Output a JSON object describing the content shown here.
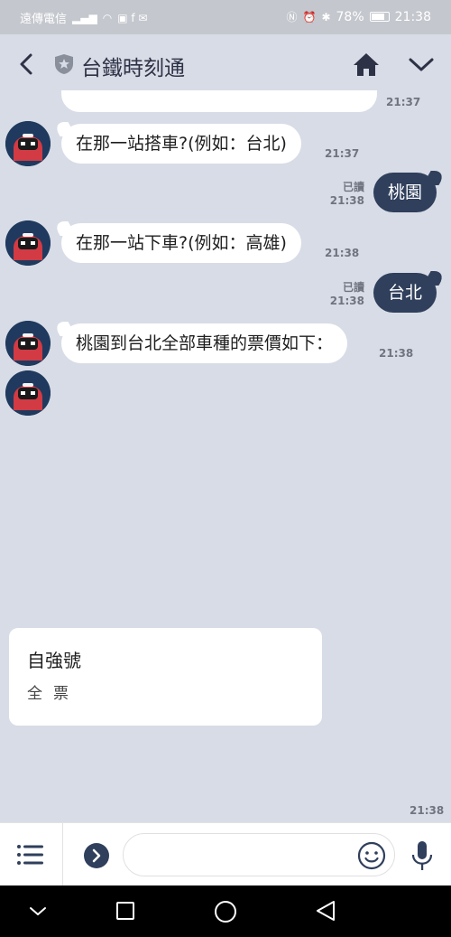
{
  "status_bar": {
    "carrier": "遠傳電信",
    "battery": "78%",
    "battery_level": 0.78,
    "time": "21:38"
  },
  "header": {
    "title": "台鐵時刻通",
    "icons": [
      "back-icon",
      "shield-star-icon",
      "home-icon",
      "chevron-down-icon"
    ]
  },
  "chat": {
    "partial_time": "21:37",
    "messages": [
      {
        "from": "bot",
        "text": "在那一站搭車?(例如：台北)",
        "time": "21:37"
      },
      {
        "from": "user",
        "text": "桃園",
        "read": "已讀",
        "time": "21:38"
      },
      {
        "from": "bot",
        "text": "在那一站下車?(例如：高雄)",
        "time": "21:38"
      },
      {
        "from": "user",
        "text": "台北",
        "read": "已讀",
        "time": "21:38"
      },
      {
        "from": "bot",
        "text": "桃園到台北全部車種的票價如下：",
        "time": "21:38"
      }
    ],
    "card": {
      "title": "自強號",
      "subtitle": "全票",
      "time": "21:38"
    }
  },
  "input": {
    "placeholder": ""
  },
  "colors": {
    "chat_bg": "#d8dce6",
    "user_bubble": "#2f3f5c",
    "status_bar": "#c4c7cd"
  }
}
